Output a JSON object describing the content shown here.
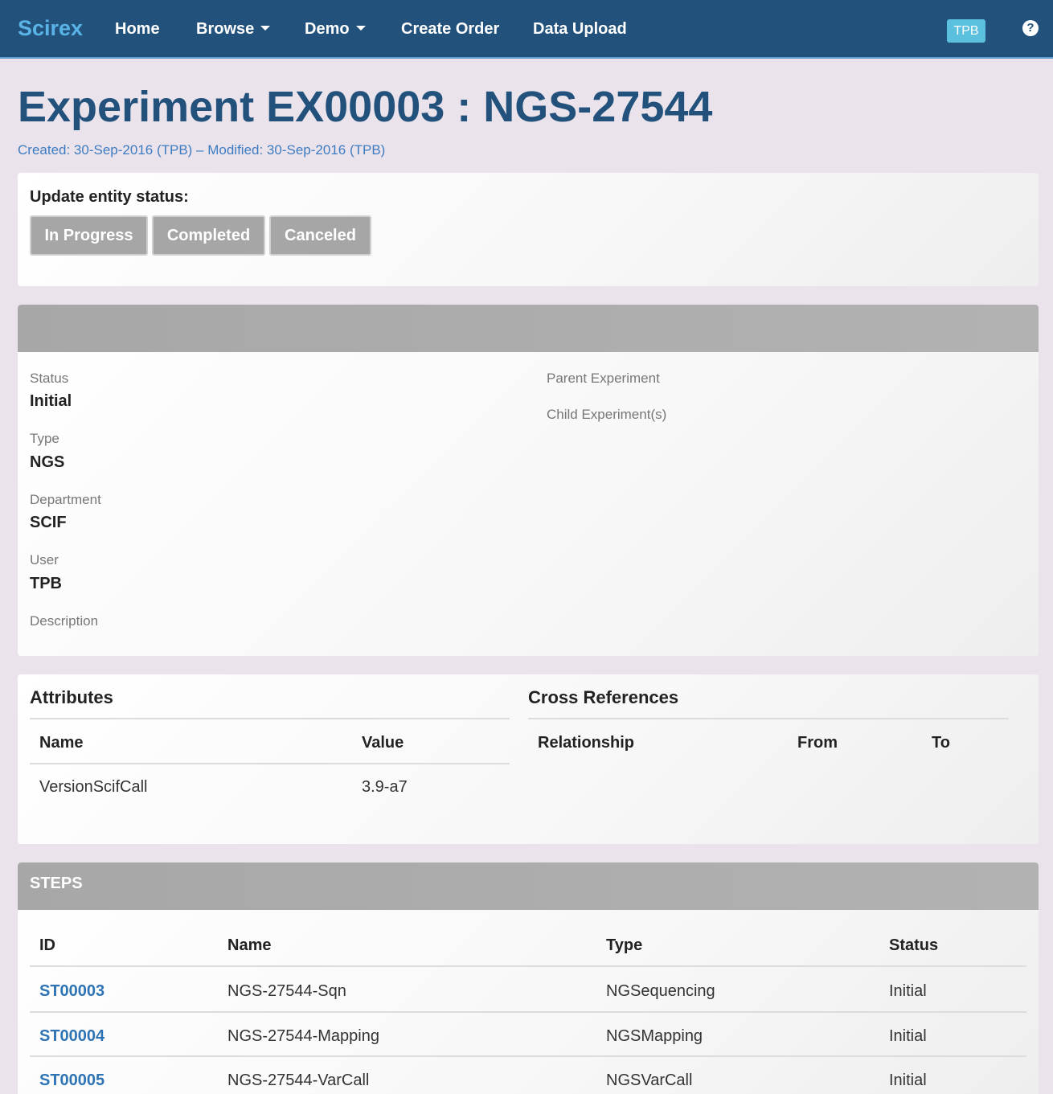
{
  "nav": {
    "brand": "Scirex",
    "items": [
      {
        "label": "Home"
      },
      {
        "label": "Browse"
      },
      {
        "label": "Demo"
      },
      {
        "label": "Create Order"
      },
      {
        "label": "Data Upload"
      }
    ],
    "user": "TPB",
    "help": "?"
  },
  "page": {
    "title": "Experiment EX00003 : NGS-27544",
    "meta": "Created: 30-Sep-2016 (TPB) – Modified: 30-Sep-2016 (TPB)"
  },
  "status_update": {
    "label": "Update entity status:",
    "buttons": [
      "In Progress",
      "Completed",
      "Canceled"
    ]
  },
  "details": {
    "status_label": "Status",
    "status_value": "Initial",
    "type_label": "Type",
    "type_value": "NGS",
    "department_label": "Department",
    "department_value": "SCIF",
    "user_label": "User",
    "user_value": "TPB",
    "description_label": "Description",
    "parent_label": "Parent Experiment",
    "child_label": "Child Experiment(s)"
  },
  "attributes": {
    "title": "Attributes",
    "headers": [
      "Name",
      "Value"
    ],
    "rows": [
      [
        "VersionScifCall",
        "3.9-a7"
      ]
    ]
  },
  "cross_refs": {
    "title": "Cross References",
    "headers": [
      "Relationship",
      "From",
      "To"
    ]
  },
  "steps": {
    "title": "STEPS",
    "headers": [
      "ID",
      "Name",
      "Type",
      "Status"
    ],
    "rows": [
      [
        "ST00003",
        "NGS-27544-Sqn",
        "NGSequencing",
        "Initial"
      ],
      [
        "ST00004",
        "NGS-27544-Mapping",
        "NGSMapping",
        "Initial"
      ],
      [
        "ST00005",
        "NGS-27544-VarCall",
        "NGSVarCall",
        "Initial"
      ]
    ]
  }
}
